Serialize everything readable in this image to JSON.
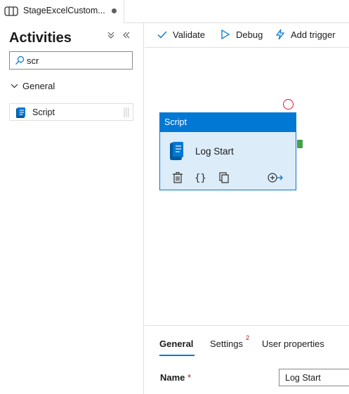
{
  "tab": {
    "title": "StageExcelCustom...",
    "unsaved": true
  },
  "activities_panel": {
    "title": "Activities",
    "expand_all_icon": "double-chevron-down",
    "collapse_icon": "double-chevron-left",
    "search": {
      "value": "scr",
      "placeholder": "Search activities"
    },
    "group": {
      "label": "General",
      "expanded": true
    },
    "items": [
      {
        "label": "Script",
        "icon": "script-icon"
      }
    ]
  },
  "toolbar": {
    "validate_label": "Validate",
    "debug_label": "Debug",
    "add_trigger_label": "Add trigger"
  },
  "canvas": {
    "node": {
      "type_label": "Script",
      "name": "Log Start",
      "icon": "script-icon"
    }
  },
  "properties": {
    "tabs": [
      {
        "label": "General",
        "active": true
      },
      {
        "label": "Settings",
        "badge": "2"
      },
      {
        "label": "User properties"
      }
    ],
    "fields": {
      "name_label": "Name",
      "name_required": "*",
      "name_value": "Log Start"
    }
  },
  "colors": {
    "accent": "#0078d4",
    "node_fill": "#dcecf9",
    "error": "#e81123",
    "success": "#46a046"
  }
}
